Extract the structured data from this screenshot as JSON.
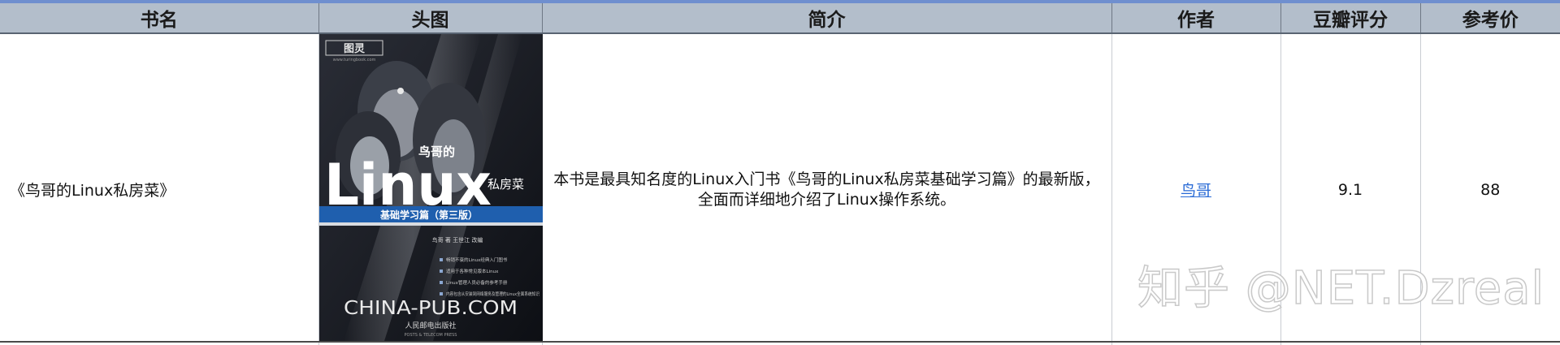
{
  "table": {
    "headers": [
      "书名",
      "头图",
      "简介",
      "作者",
      "豆瓣评分",
      "参考价"
    ],
    "rows": [
      {
        "title": "《鸟哥的Linux私房菜》",
        "cover": {
          "publisher_logo": "图灵",
          "publisher_logo_sub": "www.turingbook.com",
          "title_small": "鸟哥的",
          "title_big": "Linux",
          "title_tail": "私房菜",
          "subtitle": "基础学习篇（第三版）",
          "authors": "鸟哥  著        王世江  改编",
          "bullets": [
            "畅销不衰的Linux经典入门图书",
            "适用于各种常见版本Linux",
            "Linux管理人员必备的参考手册",
            "内容包含从安装到网络服务及管理的Linux全面系统知识"
          ],
          "watermark": "CHINA-PUB.COM",
          "press": "人民邮电出版社",
          "press_en": "POSTS & TELECOM PRESS"
        },
        "description": "本书是最具知名度的Linux入门书《鸟哥的Linux私房菜基础学习篇》的最新版，全面而详细地介绍了Linux操作系统。",
        "author": "鸟哥",
        "rating": "9.1",
        "price": "88"
      }
    ]
  },
  "watermark": "知乎 @NET.Dzreal",
  "colors": {
    "header_bg": "#b3becb",
    "accent_line": "#6f8fcf",
    "link": "#2a6bd6",
    "cover_bg": "#14161c",
    "cover_band": "#1f5fae"
  }
}
